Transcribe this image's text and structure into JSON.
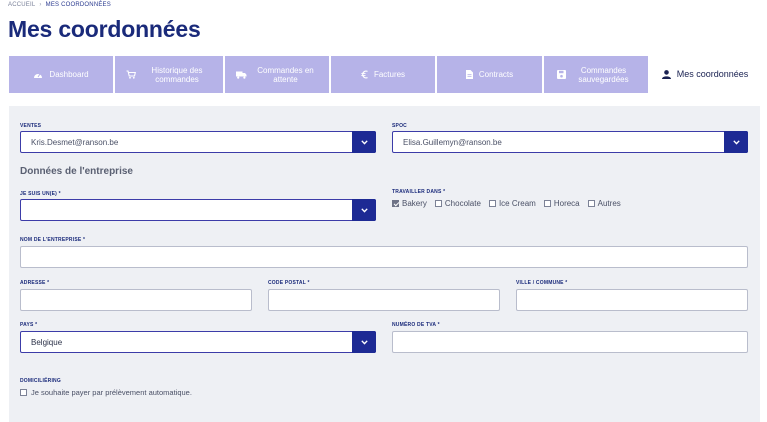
{
  "breadcrumb": {
    "home": "ACCUEIL",
    "separator": "›",
    "current": "MES COORDONNÉES"
  },
  "page_title": "Mes coordonnées",
  "tabs": [
    {
      "label": "Dashboard",
      "icon": "dashboard-gauge-icon",
      "active": false
    },
    {
      "label": "Historique des commandes",
      "icon": "cart-icon",
      "active": false
    },
    {
      "label": "Commandes en attente",
      "icon": "truck-icon",
      "active": false
    },
    {
      "label": "Factures",
      "icon": "euro-icon",
      "active": false
    },
    {
      "label": "Contracts",
      "icon": "file-icon",
      "active": false
    },
    {
      "label": "Commandes sauvegardées",
      "icon": "save-icon",
      "active": false
    },
    {
      "label": "Mes coordonnées",
      "icon": "user-icon",
      "active": true
    }
  ],
  "form": {
    "ventes": {
      "label": "VENTES",
      "value": "Kris.Desmet@ranson.be"
    },
    "spoc": {
      "label": "SPOC",
      "value": "Elisa.Guillemyn@ranson.be"
    },
    "section_title": "Données de l'entreprise",
    "je_suis": {
      "label": "JE SUIS UN(E) *",
      "value": ""
    },
    "travailler": {
      "label": "TRAVAILLER DANS *",
      "options": [
        {
          "label": "Bakery",
          "checked": true
        },
        {
          "label": "Chocolate",
          "checked": false
        },
        {
          "label": "Ice Cream",
          "checked": false
        },
        {
          "label": "Horeca",
          "checked": false
        },
        {
          "label": "Autres",
          "checked": false
        }
      ]
    },
    "nom_entreprise": {
      "label": "NOM DE L'ENTREPRISE *",
      "value": ""
    },
    "adresse": {
      "label": "ADRESSE *",
      "value": ""
    },
    "code_postal": {
      "label": "CODE POSTAL *",
      "value": ""
    },
    "ville": {
      "label": "VILLE / COMMUNE *",
      "value": ""
    },
    "pays": {
      "label": "PAYS *",
      "value": "Belgique"
    },
    "tva": {
      "label": "NUMÉRO DE TVA *",
      "value": ""
    },
    "domiciliering": {
      "label": "DOMICILIËRING",
      "option": "Je souhaite payer par prélèvement automatique.",
      "checked": false
    }
  },
  "colors": {
    "tab_bg": "#b6b3e8",
    "accent": "#1d2a94",
    "title": "#1a2a7a",
    "panel": "#eef0f4"
  }
}
